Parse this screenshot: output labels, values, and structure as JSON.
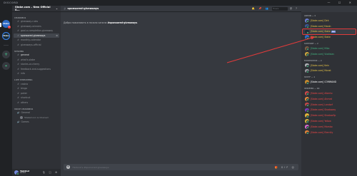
{
  "window": {
    "brand": "DISCORD",
    "controls": "— ☐ ✕"
  },
  "servers": [
    {
      "abbr": "Stake",
      "name": "Stake.com"
    },
    {
      "abbr": "Stake",
      "name": "Stake"
    }
  ],
  "server_badge": "1",
  "add_server": "+",
  "explore": "⌖",
  "guild": {
    "name": "Stake.com – New Official S...",
    "dropdown": "⌄"
  },
  "channel_groups": [
    {
      "category": "Channels",
      "channels": [
        {
          "name": "giveaway-rules",
          "state": "normal"
        },
        {
          "name": "giveaway-winners",
          "state": "normal"
        },
        {
          "name": "goal-a-completion-giveaway",
          "state": "normal"
        },
        {
          "name": "sponsored-giveaways",
          "state": "active",
          "mark": "⚙"
        },
        {
          "name": "monthly-calendar",
          "state": "normal"
        },
        {
          "name": "giveaways-official",
          "state": "normal"
        }
      ]
    },
    {
      "category": "Staking",
      "channels": [
        {
          "name": "general",
          "state": "bright"
        },
        {
          "name": "what's-stake",
          "state": "normal"
        },
        {
          "name": "stories-or-cherry",
          "state": "normal"
        },
        {
          "name": "feedback-and-suggestions",
          "state": "normal"
        },
        {
          "name": "info",
          "state": "normal"
        }
      ]
    },
    {
      "category": "Live Streaming",
      "channels": [
        {
          "name": "casino",
          "state": "normal"
        },
        {
          "name": "bingo",
          "state": "normal"
        },
        {
          "name": "poker",
          "state": "normal"
        },
        {
          "name": "shortcut",
          "state": "normal"
        },
        {
          "name": "others",
          "state": "normal"
        }
      ]
    }
  ],
  "voice": {
    "category": "Voice Channels",
    "channel": "General",
    "members": [
      {
        "name": "Stakemoon is Chained"
      }
    ],
    "extra": "Games"
  },
  "user": {
    "name": "TakiZed",
    "tag": "#2345",
    "controls": "🎙 🎧 ⚙"
  },
  "chat": {
    "channel": "sponsored-giveaways",
    "welcome_prefix": "Добро пожаловать в начало канала ",
    "welcome_channel": "#sponsored-giveaways",
    "welcome_suffix": ".",
    "search_placeholder": "Поиск",
    "header_icons": "🔔 📌 👥",
    "help_icons": "@ ?",
    "composer_placeholder": "Написать #sponsored-giveaways",
    "composer_icons": "🎁 GIF ☺"
  },
  "member_groups": [
    {
      "role": "Admin — 4",
      "members": [
        {
          "name": "[Stake.com] Dirk",
          "color": "#e8c547",
          "avatar": "#6a7fd0"
        },
        {
          "name": "[Stake.com] Edwin",
          "color": "#e8c547",
          "avatar": "#3b5998"
        },
        {
          "name": "[Stake.com] Stake",
          "color": "#e8c547",
          "avatar": "#1a2c38",
          "tag": "BOT",
          "highlight": true
        },
        {
          "name": "[Stake.com] Stake",
          "color": "#e8c547",
          "avatar": "#2e6bc6"
        }
      ]
    },
    {
      "role": "Support — 2",
      "members": [
        {
          "name": "[Stake.com] Mika",
          "color": "#43b581",
          "avatar": "#7a5e43"
        },
        {
          "name": "[Stake.com] Vladislav",
          "color": "#43b581",
          "avatar": "#c9a53e"
        }
      ]
    },
    {
      "role": "Moderator — 2",
      "members": [
        {
          "name": "[Stake.com] Kein",
          "color": "#e8c547",
          "avatar": "#b0b3b8"
        },
        {
          "name": "[Stake.com] Monst",
          "color": "#e8c547",
          "avatar": "#9a9da3"
        }
      ]
    },
    {
      "role": "Staff — 1",
      "members": [
        {
          "name": "[Stake.com] COMMAND",
          "color": "#ffffff",
          "avatar": "#c2892f"
        }
      ]
    },
    {
      "role": "Verified — 99",
      "members": [
        {
          "name": "[Stake.com] Alberto",
          "color": "#f04747",
          "avatar": "#d04a4a"
        },
        {
          "name": "[Stake.com] Ahmed",
          "color": "#f04747",
          "avatar": "#e08a3a"
        },
        {
          "name": "[Stake.com] Landorf",
          "color": "#f04747",
          "avatar": "#c24848"
        },
        {
          "name": "[Stake.com] Shadoway",
          "color": "#f04747",
          "avatar": "#7a3ec2"
        },
        {
          "name": "[Stake.com] ShadowSp",
          "color": "#f04747",
          "avatar": "#e0b33a"
        },
        {
          "name": "[Stake.com] Yellow",
          "color": "#f04747",
          "avatar": "#d2b23c"
        },
        {
          "name": "[Stake.com] Mambo",
          "color": "#f04747",
          "avatar": "#d86ad0"
        },
        {
          "name": "[Stake.com] Eternity",
          "color": "#f04747",
          "avatar": "#e0853a"
        }
      ]
    }
  ],
  "colors": {
    "annotation_arrow": "#e03a3a",
    "accent": "#7289da",
    "online": "#43b581"
  }
}
